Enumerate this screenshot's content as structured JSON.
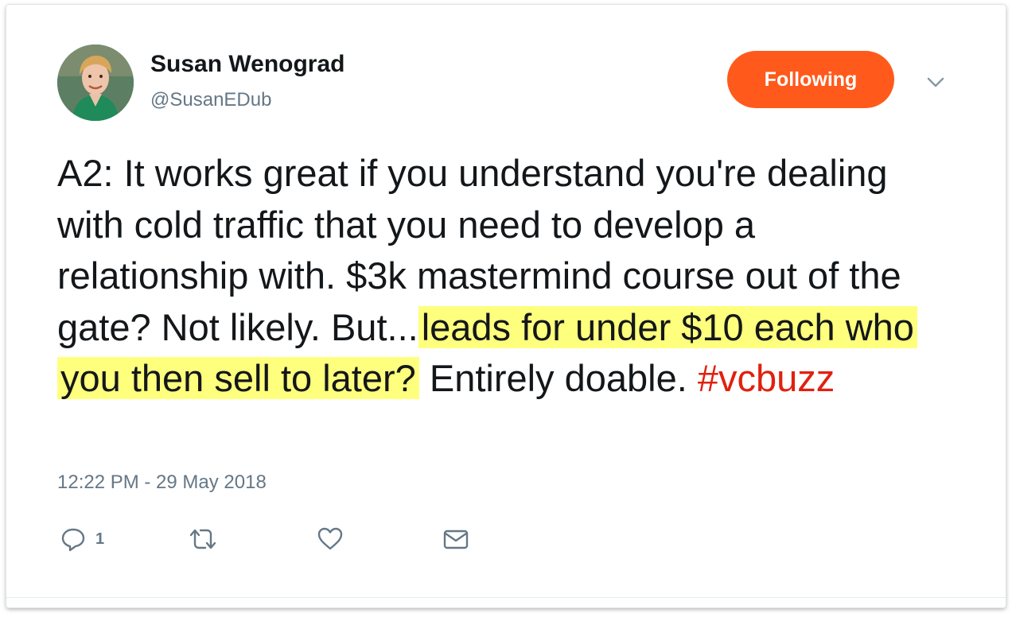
{
  "user": {
    "name": "Susan Wenograd",
    "handle": "@SusanEDub"
  },
  "follow_button": {
    "label": "Following",
    "color": "#ff5a1c"
  },
  "tweet": {
    "segment_plain_1": "A2: It works great if you understand you're dealing with cold traffic that you need to develop a relationship with. $3k mastermind course out of the gate? Not likely. But...",
    "segment_highlight": "leads for under $10 each who you then sell to later?",
    "segment_plain_2": " Entirely doable. ",
    "hashtag": "#vcbuzz",
    "highlight_color": "#ffff7e",
    "hashtag_color": "#e0210f"
  },
  "timestamp": "12:22 PM - 29 May 2018",
  "actions": {
    "reply_count": "1",
    "icons": [
      "reply-icon",
      "retweet-icon",
      "like-icon",
      "direct-message-icon",
      "chevron-down-icon"
    ]
  }
}
